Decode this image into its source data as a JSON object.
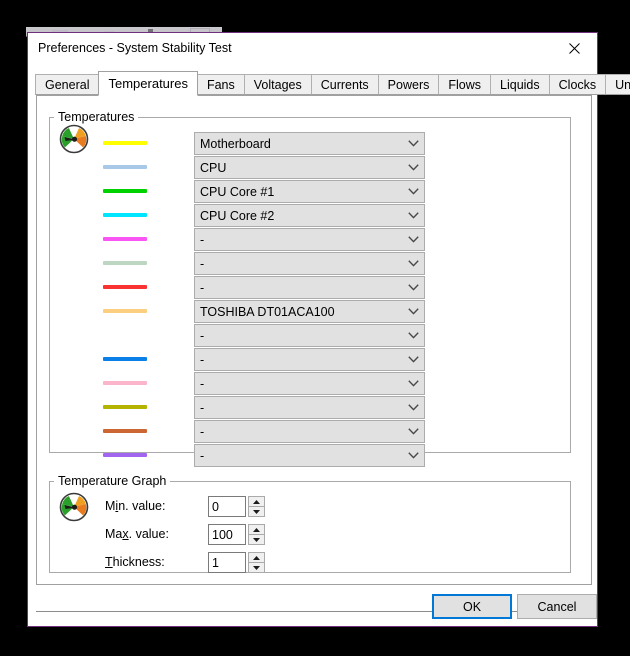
{
  "window": {
    "title": "Preferences - System Stability Test",
    "close_icon": "close-icon"
  },
  "tabs": [
    {
      "label": "General",
      "active": false
    },
    {
      "label": "Temperatures",
      "active": true
    },
    {
      "label": "Fans",
      "active": false
    },
    {
      "label": "Voltages",
      "active": false
    },
    {
      "label": "Currents",
      "active": false
    },
    {
      "label": "Powers",
      "active": false
    },
    {
      "label": "Flows",
      "active": false
    },
    {
      "label": "Liquids",
      "active": false
    },
    {
      "label": "Clocks",
      "active": false
    },
    {
      "label": "Unified",
      "active": false
    }
  ],
  "temperatures_group": {
    "label": "Temperatures",
    "icon": "gauge-icon",
    "rows": [
      {
        "color": "#ffff00",
        "value": "Motherboard"
      },
      {
        "color": "#a8c8e8",
        "value": "CPU"
      },
      {
        "color": "#00d200",
        "value": "CPU Core #1"
      },
      {
        "color": "#00e5ff",
        "value": "CPU Core #2"
      },
      {
        "color": "#f955f5",
        "value": "-"
      },
      {
        "color": "#bcd6c2",
        "value": "-"
      },
      {
        "color": "#f93232",
        "value": "-"
      },
      {
        "color": "#fccf80",
        "value": "TOSHIBA DT01ACA100"
      },
      {
        "color": "",
        "value": "-"
      },
      {
        "color": "#0a7fe8",
        "value": "-"
      },
      {
        "color": "#fcb6cc",
        "value": "-"
      },
      {
        "color": "#b4b400",
        "value": "-"
      },
      {
        "color": "#cc6633",
        "value": "-"
      },
      {
        "color": "#a265f0",
        "value": "-"
      }
    ]
  },
  "graph_group": {
    "label": "Temperature Graph",
    "icon": "gauge-icon",
    "fields": [
      {
        "label_pre": "M",
        "label_accel": "i",
        "label_post": "n. value:",
        "value": "0",
        "name": "min-value"
      },
      {
        "label_pre": "Ma",
        "label_accel": "x",
        "label_post": ". value:",
        "value": "100",
        "name": "max-value"
      },
      {
        "label_pre": "",
        "label_accel": "T",
        "label_post": "hickness:",
        "value": "1",
        "name": "thickness"
      }
    ]
  },
  "footer": {
    "ok_label": "OK",
    "cancel_label": "Cancel"
  }
}
